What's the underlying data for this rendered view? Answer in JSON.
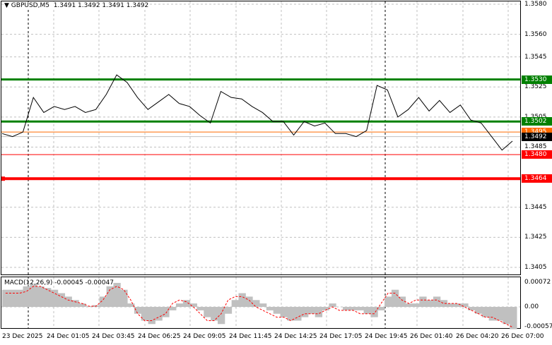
{
  "header": {
    "symbol": "GBPUSD,M5",
    "ohlc": "1.3491 1.3492 1.3491 1.3492",
    "collapse_icon": "triangle-down-icon"
  },
  "price_axis": [
    "1.3580",
    "1.3560",
    "1.3545",
    "1.3525",
    "1.3505",
    "1.3485",
    "1.3445",
    "1.3425",
    "1.3405"
  ],
  "levels": [
    {
      "label": "1.3530",
      "value": 1.353,
      "color": "#008000"
    },
    {
      "label": "1.3502",
      "value": 1.3502,
      "color": "#008000"
    },
    {
      "label": "1.3495",
      "value": 1.3495,
      "color": "#ff6a00"
    },
    {
      "label": "1.3480",
      "value": 1.348,
      "color": "#ff0000"
    },
    {
      "label": "1.3464",
      "value": 1.3464,
      "color": "#ff0000"
    }
  ],
  "bid": {
    "label": "1.3492",
    "value": 1.3492
  },
  "macd": {
    "title": "MACD(12,26,9) -0.00045 -0.00047",
    "axis": [
      "0.00072",
      "0.00",
      "-0.00057"
    ],
    "hist": [
      0.0005,
      0.0005,
      0.0005,
      0.0006,
      0.00065,
      0.0006,
      0.00055,
      0.0005,
      0.0004,
      0.0003,
      0.0002,
      0.0001,
      2e-05,
      5e-05,
      0.0003,
      0.0006,
      0.0007,
      0.0005,
      0.0001,
      -0.0002,
      -0.0004,
      -0.0005,
      -0.0004,
      -0.0003,
      -0.0001,
      0.0001,
      0.0002,
      0.0001,
      -0.0001,
      -0.0003,
      -0.0004,
      -0.0005,
      -0.0002,
      0.0002,
      0.0004,
      0.0003,
      0.0002,
      0.0001,
      -0.0001,
      -0.0002,
      -0.0003,
      -0.0004,
      -0.0004,
      -0.0003,
      -0.0002,
      -0.0003,
      -0.0001,
      0.0001,
      0.0,
      -0.0001,
      -0.0001,
      -0.0001,
      -0.0002,
      -0.0003,
      -0.0001,
      0.0003,
      0.0005,
      0.0003,
      0.0001,
      0.0001,
      0.0003,
      0.0002,
      0.0003,
      0.0002,
      0.0001,
      0.0001,
      0.0001,
      -0.0001,
      -0.0002,
      -0.0003,
      -0.0004,
      -0.0004,
      -0.0005,
      -0.00065
    ],
    "signal": [
      0.0004,
      0.0004,
      0.0004,
      0.00045,
      0.0006,
      0.0006,
      0.0005,
      0.0004,
      0.0003,
      0.0002,
      0.00015,
      0.0001,
      2e-05,
      2e-05,
      0.0002,
      0.0005,
      0.0006,
      0.0005,
      0.0002,
      -0.0002,
      -0.0004,
      -0.0004,
      -0.0003,
      -0.0002,
      0.0001,
      0.0002,
      0.00015,
      0.0,
      -0.0002,
      -0.0004,
      -0.0004,
      -0.0002,
      0.0002,
      0.0003,
      0.0003,
      0.0002,
      0.0,
      -0.0001,
      -0.0002,
      -0.0003,
      -0.0003,
      -0.0004,
      -0.0003,
      -0.0002,
      -0.0002,
      -0.0002,
      -0.0001,
      0.0,
      -0.0001,
      -0.0001,
      -0.0001,
      -0.0002,
      -0.0002,
      -0.0002,
      0.0001,
      0.0004,
      0.0004,
      0.0002,
      0.0001,
      0.0002,
      0.0002,
      0.0002,
      0.0002,
      0.0001,
      0.0001,
      0.0001,
      0.0,
      -0.0001,
      -0.0002,
      -0.0003,
      -0.0003,
      -0.0004,
      -0.0005,
      -0.0006
    ]
  },
  "time_axis": [
    "23 Dec 2025",
    "24 Dec 01:05",
    "24 Dec 03:45",
    "24 Dec 06:25",
    "24 Dec 09:05",
    "24 Dec 11:45",
    "24 Dec 14:25",
    "24 Dec 17:05",
    "24 Dec 19:45",
    "26 Dec 01:40",
    "26 Dec 04:20",
    "26 Dec 07:00"
  ],
  "price_series": [
    1.3494,
    1.3492,
    1.3495,
    1.3518,
    1.3508,
    1.3512,
    1.351,
    1.3512,
    1.3508,
    1.351,
    1.352,
    1.3533,
    1.3528,
    1.3518,
    1.351,
    1.3515,
    1.352,
    1.3514,
    1.3512,
    1.3506,
    1.3501,
    1.3522,
    1.3518,
    1.3517,
    1.3512,
    1.3508,
    1.3502,
    1.3502,
    1.3493,
    1.3502,
    1.3499,
    1.3501,
    1.3494,
    1.3494,
    1.3492,
    1.3496,
    1.3526,
    1.3523,
    1.3505,
    1.351,
    1.3518,
    1.3509,
    1.3516,
    1.3508,
    1.3513,
    1.3503,
    1.3501,
    1.3492,
    1.3483,
    1.3489
  ]
}
